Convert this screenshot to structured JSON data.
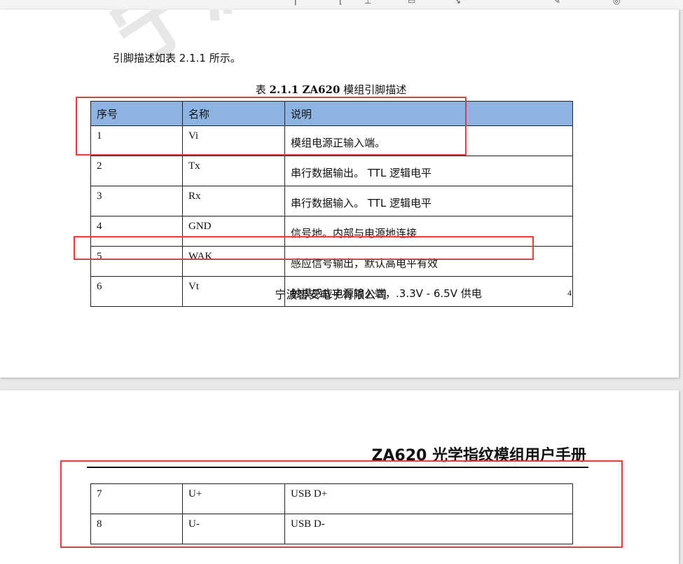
{
  "toolbar": {
    "icons": [
      "cursor-icon",
      "text-select-icon",
      "edit-icon",
      "note-icon",
      "arrow-icon",
      "pen-icon",
      "zoom-icon"
    ]
  },
  "page1": {
    "watermark": "宁波智",
    "intro": "引脚描述如表 2.1.1 所示。",
    "caption_prefix": "表",
    "caption_bold": "2.1.1 ZA620",
    "caption_suffix": "模组引脚描述",
    "table": {
      "headers": [
        "序号",
        "名称",
        "说明"
      ],
      "rows": [
        {
          "no": "1",
          "name": "Vi",
          "desc": "模组电源正输入端。"
        },
        {
          "no": "2",
          "name": "Tx",
          "desc": "串行数据输出。 TTL 逻辑电平"
        },
        {
          "no": "3",
          "name": "Rx",
          "desc": "串行数据输入。 TTL 逻辑电平"
        },
        {
          "no": "4",
          "name": "GND",
          "desc": "信号地。内部与电源地连接"
        },
        {
          "no": "5",
          "name": "WAK",
          "desc": "感应信号输出，默认高电平有效"
        },
        {
          "no": "6",
          "name": "Vt",
          "desc": "触摸感应电源输入端，.3.3V  -  6.5V 供电"
        }
      ]
    },
    "footer_company": "宁波智安电子有限公司",
    "page_number": "4"
  },
  "page2": {
    "doc_title": "ZA620 光学指纹模组用户手册",
    "table": {
      "rows": [
        {
          "no": "7",
          "name": "U+",
          "desc": "USB D+"
        },
        {
          "no": "8",
          "name": "U-",
          "desc": "USB D-"
        }
      ]
    }
  },
  "highlight_color": "#e03c3c",
  "header_fill_color": "#8db3e2"
}
